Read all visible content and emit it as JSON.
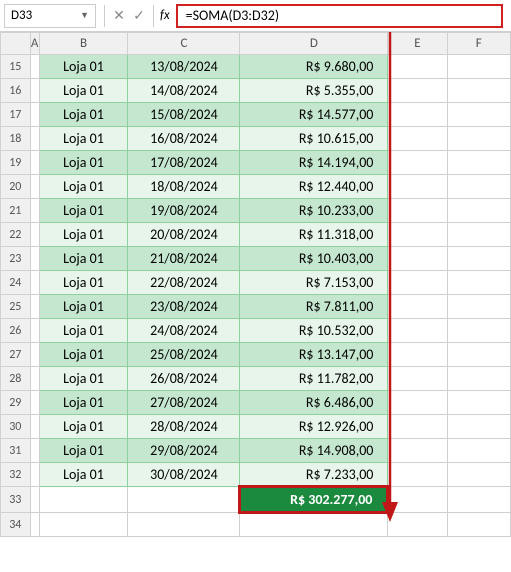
{
  "name_box": "D33",
  "fx_buttons": {
    "cancel": "✕",
    "confirm": "✓",
    "fx": "fx"
  },
  "formula": "=SOMA(D3:D32)",
  "columns": [
    "A",
    "B",
    "C",
    "D",
    "E",
    "F"
  ],
  "row_start": 15,
  "rows": [
    {
      "n": 15,
      "b": "Loja 01",
      "c": "13/08/2024",
      "d": "R$ 9.680,00"
    },
    {
      "n": 16,
      "b": "Loja 01",
      "c": "14/08/2024",
      "d": "R$ 5.355,00"
    },
    {
      "n": 17,
      "b": "Loja 01",
      "c": "15/08/2024",
      "d": "R$ 14.577,00"
    },
    {
      "n": 18,
      "b": "Loja 01",
      "c": "16/08/2024",
      "d": "R$ 10.615,00"
    },
    {
      "n": 19,
      "b": "Loja 01",
      "c": "17/08/2024",
      "d": "R$ 14.194,00"
    },
    {
      "n": 20,
      "b": "Loja 01",
      "c": "18/08/2024",
      "d": "R$ 12.440,00"
    },
    {
      "n": 21,
      "b": "Loja 01",
      "c": "19/08/2024",
      "d": "R$ 10.233,00"
    },
    {
      "n": 22,
      "b": "Loja 01",
      "c": "20/08/2024",
      "d": "R$ 11.318,00"
    },
    {
      "n": 23,
      "b": "Loja 01",
      "c": "21/08/2024",
      "d": "R$ 10.403,00"
    },
    {
      "n": 24,
      "b": "Loja 01",
      "c": "22/08/2024",
      "d": "R$ 7.153,00"
    },
    {
      "n": 25,
      "b": "Loja 01",
      "c": "23/08/2024",
      "d": "R$ 7.811,00"
    },
    {
      "n": 26,
      "b": "Loja 01",
      "c": "24/08/2024",
      "d": "R$ 10.532,00"
    },
    {
      "n": 27,
      "b": "Loja 01",
      "c": "25/08/2024",
      "d": "R$ 13.147,00"
    },
    {
      "n": 28,
      "b": "Loja 01",
      "c": "26/08/2024",
      "d": "R$ 11.782,00"
    },
    {
      "n": 29,
      "b": "Loja 01",
      "c": "27/08/2024",
      "d": "R$ 6.486,00"
    },
    {
      "n": 30,
      "b": "Loja 01",
      "c": "28/08/2024",
      "d": "R$ 12.926,00"
    },
    {
      "n": 31,
      "b": "Loja 01",
      "c": "29/08/2024",
      "d": "R$ 14.908,00"
    },
    {
      "n": 32,
      "b": "Loja 01",
      "c": "30/08/2024",
      "d": "R$ 7.233,00"
    }
  ],
  "total_row": 33,
  "total_value": "R$ 302.277,00",
  "extra_rows": [
    34
  ]
}
